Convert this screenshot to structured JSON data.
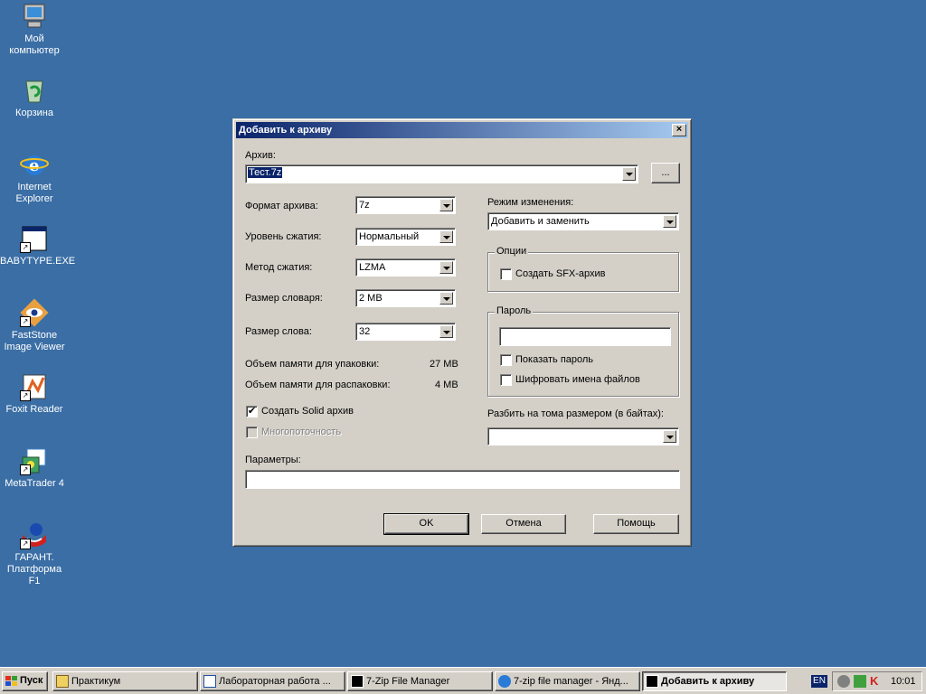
{
  "desktop": {
    "icons": [
      {
        "label_1": "Мой",
        "label_2": "компьютер"
      },
      {
        "label_1": "Корзина",
        "label_2": ""
      },
      {
        "label_1": "Internet",
        "label_2": "Explorer"
      },
      {
        "label_1": "BABYTYPE.EXE",
        "label_2": ""
      },
      {
        "label_1": "FastStone",
        "label_2": "Image Viewer"
      },
      {
        "label_1": "Foxit Reader",
        "label_2": ""
      },
      {
        "label_1": "MetaTrader 4",
        "label_2": ""
      },
      {
        "label_1": "ГАРАНТ.",
        "label_2": "Платформа F1"
      }
    ]
  },
  "dialog": {
    "title": "Добавить к архиву",
    "close": "×",
    "archive_label": "Архив:",
    "archive_value": "Тест.7z",
    "browse_label": "...",
    "format_label": "Формат архива:",
    "format_value": "7z",
    "level_label": "Уровень сжатия:",
    "level_value": "Нормальный",
    "method_label": "Метод сжатия:",
    "method_value": "LZMA",
    "dict_label": "Размер словаря:",
    "dict_value": "2 MB",
    "word_label": "Размер слова:",
    "word_value": "32",
    "mem_pack_label": "Объем памяти для упаковки:",
    "mem_pack_value": "27 MB",
    "mem_unpack_label": "Объем памяти для распаковки:",
    "mem_unpack_value": "4 MB",
    "solid_label": "Создать Solid архив",
    "solid_checked": "✔",
    "multithread_label": "Многопоточность",
    "update_mode_label": "Режим изменения:",
    "update_mode_value": "Добавить и заменить",
    "options_group": "Опции",
    "sfx_label": "Создать SFX-архив",
    "password_group": "Пароль",
    "show_password_label": "Показать пароль",
    "encrypt_names_label": "Шифровать имена файлов",
    "split_label": "Разбить на тома размером (в байтах):",
    "params_label": "Параметры:",
    "ok_label": "OK",
    "cancel_label": "Отмена",
    "help_label": "Помощь"
  },
  "taskbar": {
    "start_label": "Пуск",
    "tasks": [
      {
        "label": "Практикум"
      },
      {
        "label": "Лабораторная работа ..."
      },
      {
        "label": "7-Zip File Manager"
      },
      {
        "label": "7-zip file manager - Янд..."
      },
      {
        "label": "Добавить к архиву"
      }
    ],
    "lang": "EN",
    "time": "10:01"
  },
  "colors": {
    "desktop": "#3a6ea5",
    "title_active": "#0a246a",
    "face": "#d4d0c8"
  }
}
